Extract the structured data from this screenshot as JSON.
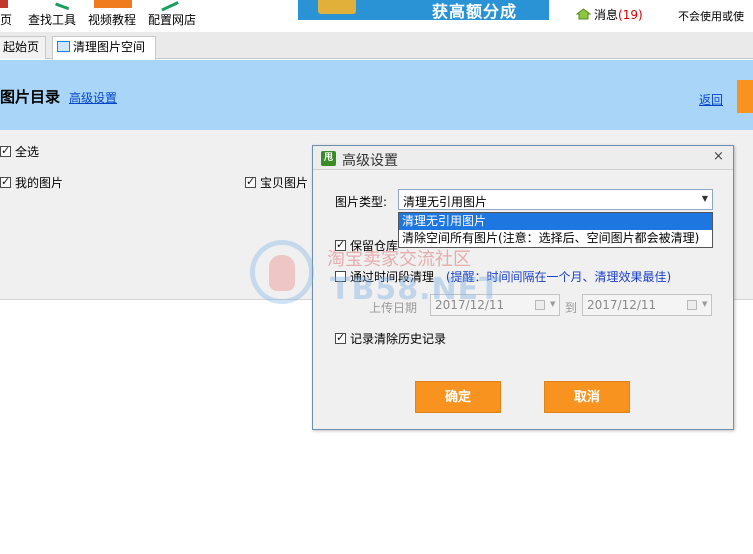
{
  "toolbar": {
    "items": [
      {
        "label": "页",
        "icon": "home-icon"
      },
      {
        "label": "查找工具",
        "icon": "search-tool-icon"
      },
      {
        "label": "视频教程",
        "icon": "video-icon"
      },
      {
        "label": "配置网店",
        "icon": "store-config-icon"
      }
    ],
    "banner_text": "获高额分成",
    "messages_label": "消息",
    "messages_count": "(19)",
    "right_note": "不会使用或使"
  },
  "tabs": [
    {
      "label": "起始页",
      "active": false
    },
    {
      "label": "清理图片空间",
      "active": true,
      "icon": "image-icon"
    }
  ],
  "header": {
    "title": "图片目录",
    "advanced_link": "高级设置",
    "back_link": "返回"
  },
  "content": {
    "select_all": "全选",
    "my_images": "我的图片",
    "product_images": "宝贝图片"
  },
  "dialog": {
    "title": "高级设置",
    "logo_text": "甩",
    "close_glyph": "×",
    "type_label": "图片类型:",
    "type_value": "清理无引用图片",
    "options": [
      "清理无引用图片",
      "清除空间所有图片(注意：选择后、空间图片都会被清理)"
    ],
    "keep_label": "保留仓库",
    "by_time_label": "通过时间段清理",
    "by_time_hint": "(提醒：时间间隔在一个月、清理效果最佳)",
    "upload_date_label": "上传日期",
    "date_from": "2017/12/11",
    "to_label": "到",
    "date_to": "2017/12/11",
    "record_history_label": "记录清除历史记录",
    "confirm_label": "确定",
    "cancel_label": "取消"
  },
  "watermark": {
    "text": "淘宝卖家交流社区",
    "site": "TB58.NET"
  },
  "colors": {
    "header_blue": "#a9d6f8",
    "accent_orange": "#f7931e",
    "link_blue": "#0645c7",
    "selection_blue": "#1e76e0"
  }
}
